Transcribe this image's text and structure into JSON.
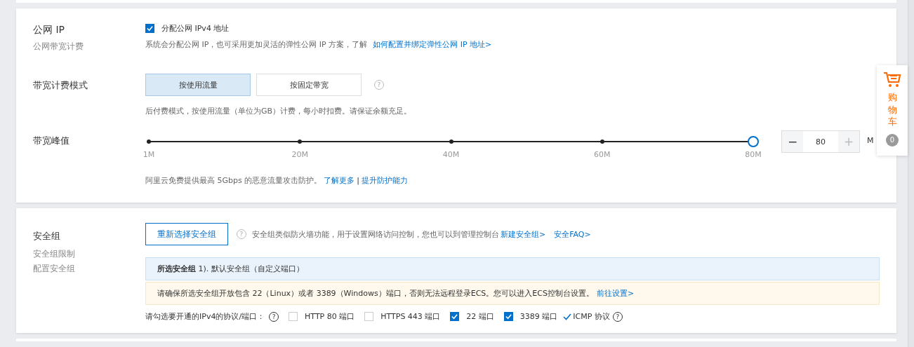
{
  "public_ip": {
    "label": "公网 IP",
    "sublabel": "公网带宽计费",
    "checkbox": {
      "label": "分配公网 IPv4 地址",
      "checked": true
    },
    "hint": {
      "text": "系统会分配公网 IP，也可采用更加灵活的弹性公网 IP 方案，了解",
      "link": "如何配置并绑定弹性公网 IP 地址>"
    }
  },
  "billing_mode": {
    "label": "带宽计费模式",
    "options": [
      {
        "label": "按使用流量",
        "selected": true
      },
      {
        "label": "按固定带宽",
        "selected": false
      }
    ],
    "help": "?",
    "hint": "后付费模式，按使用流量（单位为GB）计费，每小时扣费。请保证余额充足。"
  },
  "bandwidth": {
    "label": "带宽峰值",
    "level": 1,
    "ticks": [
      "1M",
      "20M",
      "40M",
      "60M",
      "80M"
    ],
    "minus": "−",
    "value": "80",
    "plus": "+",
    "unit": "M",
    "note": {
      "text": "阿里云免费提供最高 5Gbps 的恶意流量攻击防护。",
      "links": [
        "了解更多",
        "提升防护能力"
      ],
      "separator": "|"
    }
  },
  "security_group": {
    "label": "安全组",
    "sublabels": [
      "安全组限制",
      "配置安全组"
    ],
    "button": "重新选择安全组",
    "help": "?",
    "hint": {
      "text": "安全组类似防火墙功能，用于设置网络访问控制，您也可以到管理控制台",
      "links": [
        "新建安全组>",
        "安全FAQ>"
      ]
    },
    "selected": "**所选安全组** 1). 默认安全组（自定义端口）",
    "warning": {
      "text": "请确保所选安全组开放包含 22（Linux）或者 3389（Windows）端口，否则无法远程登录ECS。您可以进入ECS控制台设置。",
      "link": "前往设置>"
    },
    "ports_label": "请勾选要开通的IPv4的协议/端口：",
    "ports_help": "?",
    "ports": [
      {
        "kind": "checkbox",
        "label": "HTTP 80 端口",
        "checked": false
      },
      {
        "kind": "checkbox",
        "label": "HTTPS 443 端口",
        "checked": false
      },
      {
        "kind": "checkbox",
        "label": "22 端口",
        "checked": true
      },
      {
        "kind": "checkbox",
        "label": "3389 端口",
        "checked": true
      },
      {
        "kind": "tick",
        "label": "ICMP 协议",
        "checked": true,
        "help": "?"
      }
    ]
  },
  "cart": {
    "label": "购物车",
    "count": "0"
  }
}
